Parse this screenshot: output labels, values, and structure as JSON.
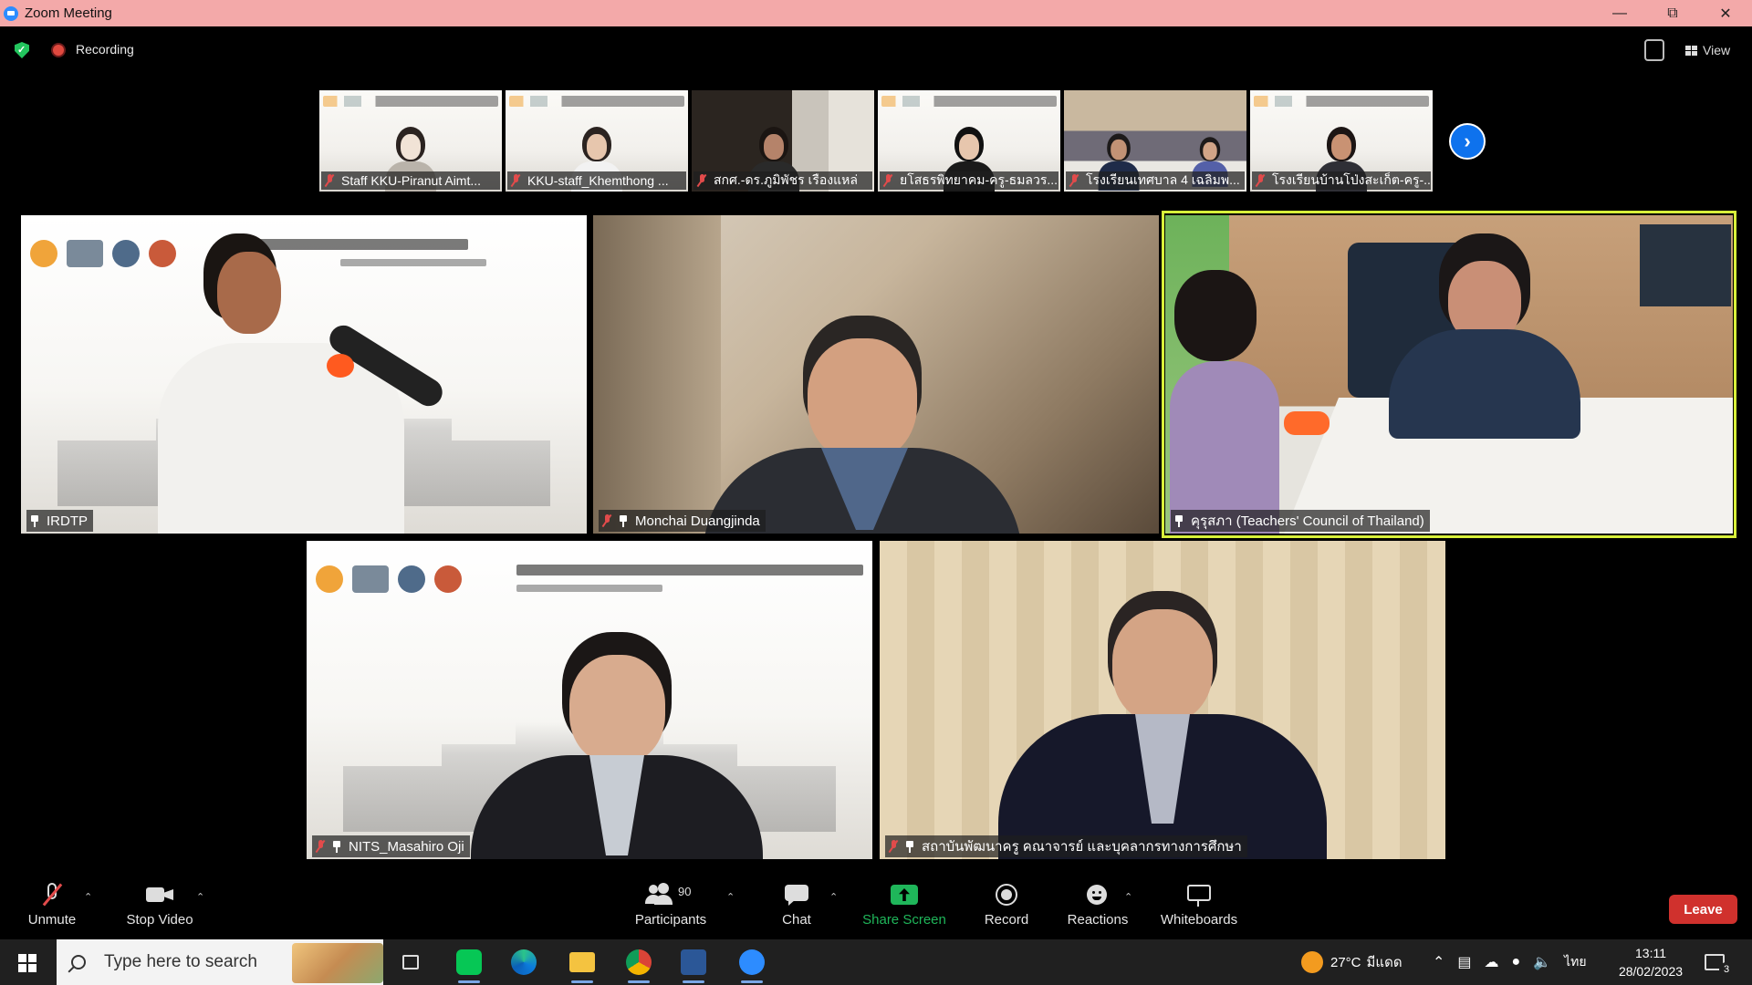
{
  "window": {
    "title": "Zoom Meeting"
  },
  "topbar": {
    "recording_label": "Recording",
    "view_label": "View"
  },
  "strip": [
    {
      "name": "Staff KKU-Piranut Aimt...",
      "muted": true
    },
    {
      "name": "KKU-staff_Khemthong ...",
      "muted": true
    },
    {
      "name": "สกศ.-ดร.ภูมิพัชร เรืองแหล่",
      "muted": true
    },
    {
      "name": "ยโสธรพิทยาคม-ครู-ธมลวร...",
      "muted": true
    },
    {
      "name": "โรงเรียนเทศบาล 4 เฉลิมพ...",
      "muted": true
    },
    {
      "name": "โรงเรียนบ้านโป่งสะเก็ต-ครู-...",
      "muted": true
    }
  ],
  "tiles": [
    {
      "name": "IRDTP",
      "muted": false,
      "pinned": true
    },
    {
      "name": "Monchai Duangjinda",
      "muted": true,
      "pinned": true
    },
    {
      "name": "คุรุสภา (Teachers' Council of Thailand)",
      "muted": false,
      "pinned": true,
      "active_speaker": true
    },
    {
      "name": "NITS_Masahiro Oji",
      "muted": true,
      "pinned": true
    },
    {
      "name": "สถาบันพัฒนาครู คณาจารย์ และบุคลากรทางการศึกษา",
      "muted": true,
      "pinned": true
    }
  ],
  "toolbar": {
    "unmute": "Unmute",
    "stop_video": "Stop Video",
    "participants": "Participants",
    "participants_count": "90",
    "chat": "Chat",
    "share_screen": "Share Screen",
    "record": "Record",
    "reactions": "Reactions",
    "whiteboards": "Whiteboards",
    "leave": "Leave"
  },
  "taskbar": {
    "search_placeholder": "Type here to search",
    "weather_temp": "27°C",
    "weather_desc": "มีแดด",
    "language": "ไทย",
    "time": "13:11",
    "date": "28/02/2023",
    "notifications": "3"
  },
  "colors": {
    "active_speaker_border": "#d8f03a",
    "leave": "#d0312d",
    "share_screen": "#1fb65a",
    "titlebar": "#f3a9a9"
  }
}
